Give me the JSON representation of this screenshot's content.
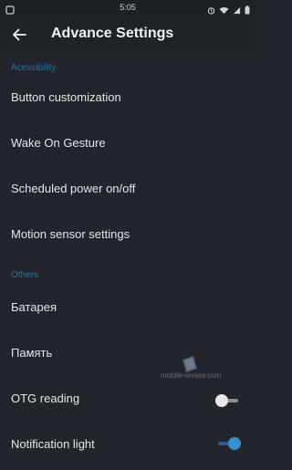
{
  "status": {
    "time": "5:05",
    "icons": [
      "alarm-icon",
      "wifi-icon",
      "signal-icon",
      "battery-icon"
    ]
  },
  "appbar": {
    "title": "Advance Settings",
    "back_icon": "back-arrow-icon"
  },
  "sections": [
    {
      "header": "Acessibility",
      "items": [
        {
          "label": "Button customization"
        },
        {
          "label": "Wake On Gesture"
        },
        {
          "label": "Scheduled power on/off"
        },
        {
          "label": "Motion sensor settings"
        }
      ]
    },
    {
      "header": "Others",
      "items": [
        {
          "label": "Батарея"
        },
        {
          "label": "Память"
        },
        {
          "label": "OTG reading",
          "toggle": false
        },
        {
          "label": "Notification light",
          "toggle": true
        }
      ]
    }
  ],
  "watermark": "mobile-review.com",
  "colors": {
    "background": "#22252b",
    "section_header": "#2f6f9a",
    "toggle_on": "#3b8fd1",
    "toggle_off": "#e8e8e8"
  }
}
